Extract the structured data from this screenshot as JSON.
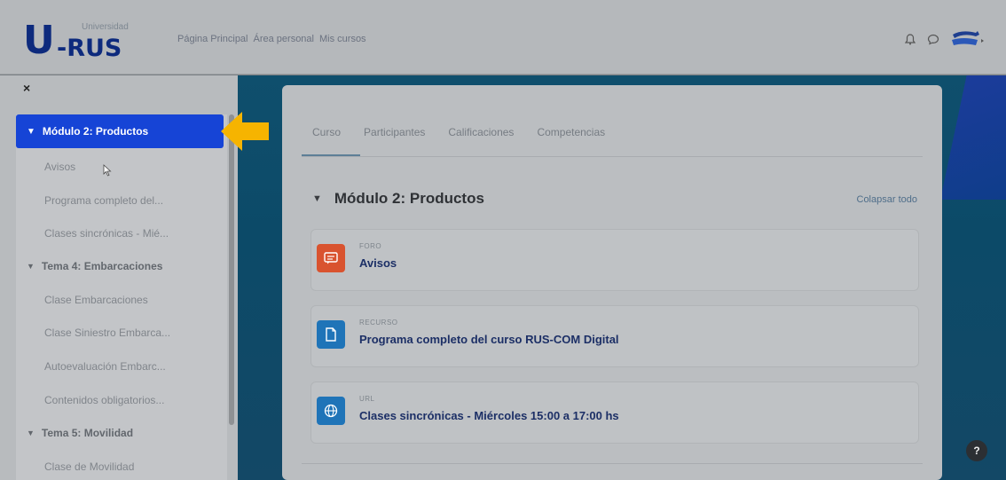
{
  "logo": {
    "main": "U",
    "sub": "-RUS",
    "small1": "Universidad",
    "small2": ""
  },
  "topnav": [
    "Página Principal",
    "Área personal",
    "Mis cursos"
  ],
  "icons": {
    "bell": "bell-icon",
    "chat": "chat-icon",
    "close": "close-icon"
  },
  "drawer": {
    "close": "×",
    "active_section": "Módulo 2: Productos",
    "items": [
      {
        "label": "Avisos"
      },
      {
        "label": "Programa completo del..."
      },
      {
        "label": "Clases sincrónicas - Mié..."
      }
    ],
    "section2": "Tema 4: Embarcaciones",
    "items2": [
      {
        "label": "Clase Embarcaciones"
      },
      {
        "label": "Clase Siniestro Embarca..."
      },
      {
        "label": "Autoevaluación Embarc..."
      },
      {
        "label": "Contenidos obligatorios..."
      }
    ],
    "section3": "Tema 5: Movilidad",
    "items3": [
      {
        "label": "Clase de Movilidad"
      }
    ]
  },
  "tabs": [
    "Curso",
    "Participantes",
    "Calificaciones",
    "Competencias"
  ],
  "module": {
    "title": "Módulo 2: Productos",
    "collapse": "Colapsar todo"
  },
  "activities": [
    {
      "type": "FORO",
      "name": "Avisos",
      "color": "#d9532f"
    },
    {
      "type": "RECURSO",
      "name": "Programa completo del curso RUS-COM Digital",
      "color": "#1f74b8"
    },
    {
      "type": "URL",
      "name": "Clases sincrónicas - Miércoles 15:00 a 17:00 hs",
      "color": "#1f74b8"
    }
  ],
  "help": "?",
  "accent": "#1644d6",
  "arrow_color": "#f6b400"
}
